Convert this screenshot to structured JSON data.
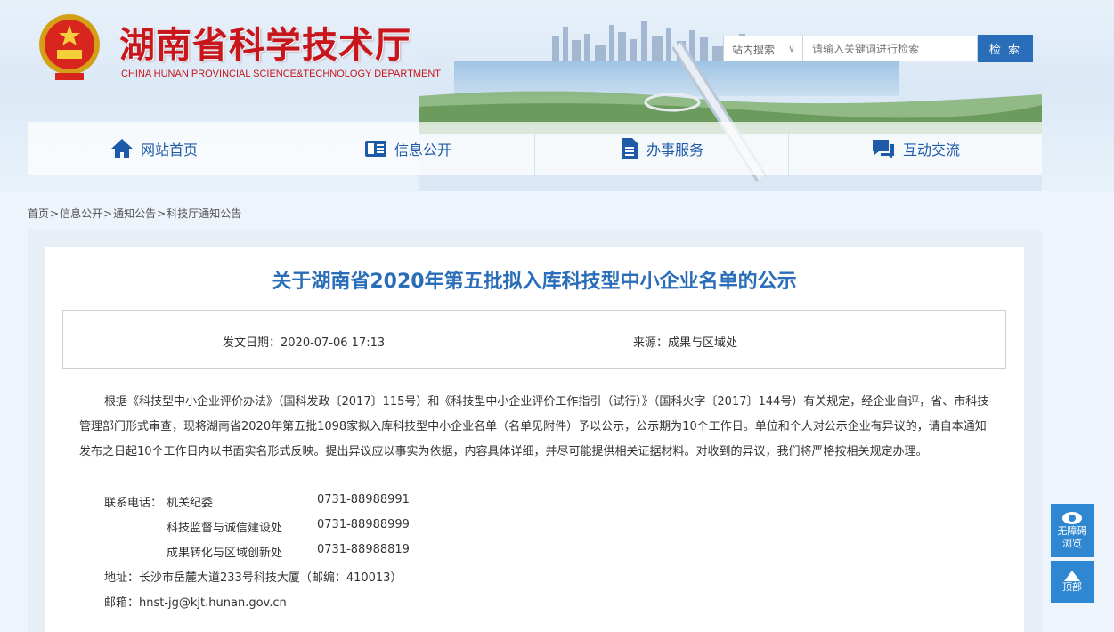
{
  "header": {
    "site_title": "湖南省科学技术厅",
    "site_subtitle": "CHINA HUNAN PROVINCIAL SCIENCE&TECHNOLOGY DEPARTMENT"
  },
  "search": {
    "scope_label": "站内搜索",
    "scope_arrow": "∨",
    "placeholder": "请输入关键词进行检索",
    "button_label": "检 索"
  },
  "nav": {
    "items": [
      {
        "label": "网站首页",
        "icon": "home-icon"
      },
      {
        "label": "信息公开",
        "icon": "info-icon"
      },
      {
        "label": "办事服务",
        "icon": "document-icon"
      },
      {
        "label": "互动交流",
        "icon": "chat-icon"
      }
    ]
  },
  "breadcrumb": {
    "items": [
      "首页",
      "信息公开",
      "通知公告",
      "科技厅通知公告"
    ],
    "separator": ">"
  },
  "article": {
    "title": "关于湖南省2020年第五批拟入库科技型中小企业名单的公示",
    "date": "发文日期：2020-07-06 17:13",
    "source": "来源：成果与区域处",
    "body": "根据《科技型中小企业评价办法》（国科发政〔2017〕115号）和《科技型中小企业评价工作指引（试行）》（国科火字〔2017〕144号）有关规定，经企业自评，省、市科技管理部门形式审查，现将湖南省2020年第五批1098家拟入库科技型中小企业名单（名单见附件）予以公示，公示期为10个工作日。单位和个人对公示企业有异议的，请自本通知发布之日起10个工作日内以书面实名形式反映。提出异议应以事实为依据，内容具体详细，并尽可能提供相关证据材料。对收到的异议，我们将严格按相关规定办理。",
    "contact_label": "联系电话：",
    "contacts": [
      {
        "dept": "机关纪委",
        "phone": "0731-88988991"
      },
      {
        "dept": "科技监督与诚信建设处",
        "phone": "0731-88988999"
      },
      {
        "dept": "成果转化与区域创新处",
        "phone": "0731-88988819"
      }
    ],
    "address": "地址：长沙市岳麓大道233号科技大厦（邮编：410013）",
    "email": "邮箱：hnst-jg@kjt.hunan.gov.cn"
  },
  "floating": {
    "accessibility_label_1": "无障碍",
    "accessibility_label_2": "浏览",
    "top_label": "顶部"
  },
  "colors": {
    "brand_red": "#c8161d",
    "brand_blue": "#2a6db8",
    "float_blue": "#2f86d1"
  }
}
